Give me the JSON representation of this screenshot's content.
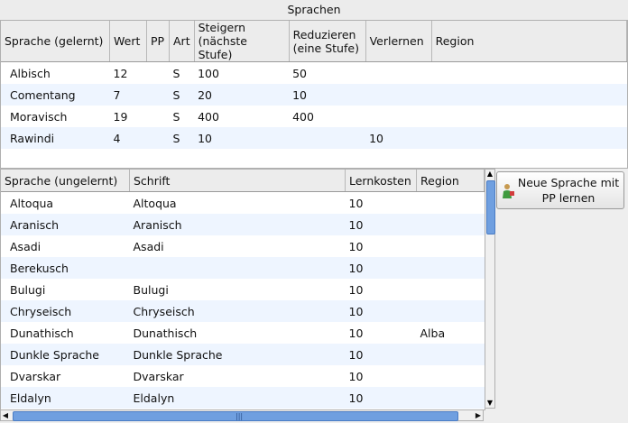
{
  "window": {
    "title": "Sprachen"
  },
  "learned": {
    "headers": [
      "Sprache (gelernt)",
      "Wert",
      "PP",
      "Art",
      "Steigern\n(nächste Stufe)",
      "Reduzieren\n(eine Stufe)",
      "Verlernen",
      "Region"
    ],
    "rows": [
      [
        "Albisch",
        "12",
        "",
        "S",
        "100",
        "50",
        "",
        ""
      ],
      [
        "Comentang",
        "7",
        "",
        "S",
        "20",
        "10",
        "",
        ""
      ],
      [
        "Moravisch",
        "19",
        "",
        "S",
        "400",
        "400",
        "",
        ""
      ],
      [
        "Rawindi",
        "4",
        "",
        "S",
        "10",
        "",
        "10",
        ""
      ]
    ]
  },
  "unlearned": {
    "headers": [
      "Sprache (ungelernt)",
      "Schrift",
      "Lernkosten",
      "Region"
    ],
    "rows": [
      [
        "Altoqua",
        "Altoqua",
        "10",
        ""
      ],
      [
        "Aranisch",
        "Aranisch",
        "10",
        ""
      ],
      [
        "Asadi",
        "Asadi",
        "10",
        ""
      ],
      [
        "Berekusch",
        "",
        "10",
        ""
      ],
      [
        "Bulugi",
        "Bulugi",
        "10",
        ""
      ],
      [
        "Chryseisch",
        "Chryseisch",
        "10",
        ""
      ],
      [
        "Dunathisch",
        "Dunathisch",
        "10",
        "Alba"
      ],
      [
        "Dunkle Sprache",
        "Dunkle Sprache",
        "10",
        ""
      ],
      [
        "Dvarskar",
        "Dvarskar",
        "10",
        ""
      ],
      [
        "Eldalyn",
        "Eldalyn",
        "10",
        ""
      ]
    ]
  },
  "button": {
    "label": "Neue Sprache mit PP lernen",
    "icon": "person-learn-icon"
  },
  "scrollbars": {
    "vertical_position": 0.0,
    "horizontal_position": 0.0
  }
}
